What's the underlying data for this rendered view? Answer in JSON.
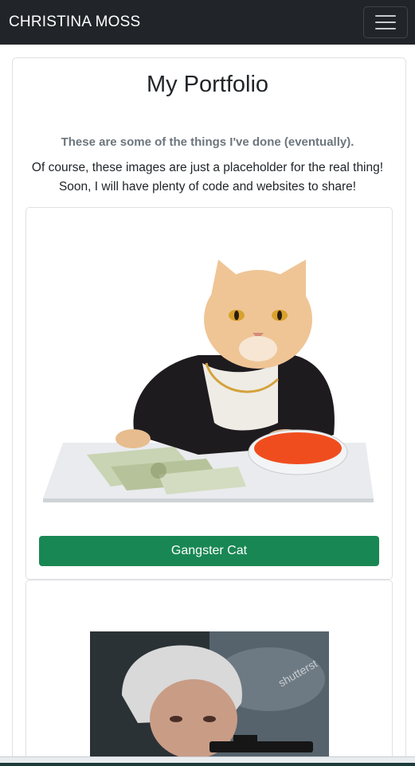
{
  "navbar": {
    "brand": "CHRISTINA MOSS"
  },
  "header": {
    "title": "My Portfolio",
    "lead": "These are some of the things I've done (eventually).",
    "description_line1": "Of course, these images are just a placeholder for the real thing!",
    "description_line2": "Soon, I will have plenty of code and websites to share!"
  },
  "cards": [
    {
      "button_label": "Gangster Cat"
    }
  ],
  "colors": {
    "navbar_bg": "#212529",
    "button_green": "#198754",
    "muted_text": "#6c757d"
  },
  "icons": {
    "menu": "hamburger-menu-icon"
  }
}
